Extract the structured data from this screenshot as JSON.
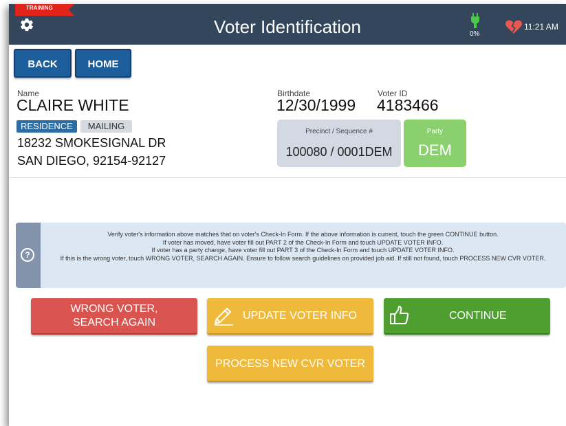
{
  "header": {
    "training_label": "TRAINING",
    "title": "Voter Identification",
    "battery_percent": "0%",
    "time": "11:21 AM",
    "icons": [
      "gear-icon",
      "plug-icon",
      "heart-icon"
    ]
  },
  "nav": {
    "back_label": "BACK",
    "home_label": "HOME"
  },
  "voter": {
    "name_label": "Name",
    "name": "CLAIRE WHITE",
    "residence_tab": "RESIDENCE",
    "mailing_tab": "MAILING",
    "address_line1": "18232 SMOKESIGNAL DR",
    "address_line2": "SAN DIEGO, 92154-92127",
    "birthdate_label": "Birthdate",
    "birthdate": "12/30/1999",
    "voter_id_label": "Voter ID",
    "voter_id": "4183466",
    "precinct_label": "Precinct / Sequence #",
    "precinct_value": "100080 / 0001DEM",
    "party_label": "Party",
    "party_value": "DEM"
  },
  "info": {
    "line1": "Verify voter's information above matches that on voter's Check-In Form. If the above information is current, touch the green CONTINUE button.",
    "line2": "If voter has moved, have voter fill out PART 2 of the Check-In Form and touch UPDATE VOTER INFO.",
    "line3": "If voter has a party change, have voter fill out PART 3 of the Check-In Form and touch UPDATE VOTER INFO.",
    "line4": "If this is the wrong voter, touch WRONG VOTER, SEARCH AGAIN. Ensure to follow search guidelines on provided job aid. If still not found, touch PROCESS NEW CVR VOTER."
  },
  "actions": {
    "wrong_voter_line1": "WRONG VOTER,",
    "wrong_voter_line2": "SEARCH AGAIN",
    "update_label": "UPDATE VOTER INFO",
    "continue_label": "CONTINUE",
    "process_label": "PROCESS NEW CVR VOTER"
  },
  "colors": {
    "header_bg": "#34465c",
    "nav_button": "#1c5d9b",
    "training_red": "#e2231a",
    "wrong_red": "#d9534f",
    "update_yellow": "#efb93b",
    "continue_green": "#4e9f2f",
    "party_green": "#8bd06e",
    "info_bg": "#dbe7f3"
  }
}
